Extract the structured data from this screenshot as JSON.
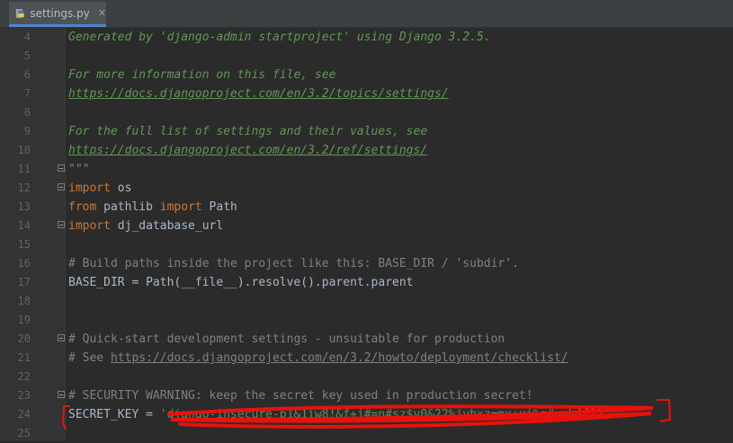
{
  "tab": {
    "filename": "settings.py",
    "icon": "python-file-icon",
    "close_glyph": "✕"
  },
  "colors": {
    "background": "#2b2b2b",
    "gutter": "#313335",
    "line_number": "#606366",
    "docstring": "#629755",
    "keyword": "#cc7832",
    "comment": "#808080",
    "string": "#6a8759",
    "text": "#a9b7c6",
    "redaction": "#e8120c"
  },
  "lines": [
    {
      "n": "4",
      "segments": [
        {
          "t": "Generated by 'django-admin startproject' using Django 3.2.5.",
          "c": "doc"
        }
      ]
    },
    {
      "n": "5",
      "segments": []
    },
    {
      "n": "6",
      "segments": [
        {
          "t": "For more information on this file, see",
          "c": "doc"
        }
      ]
    },
    {
      "n": "7",
      "segments": [
        {
          "t": "https://docs.djangoproject.com/en/3.2/topics/settings/",
          "c": "doc-link"
        }
      ]
    },
    {
      "n": "8",
      "segments": []
    },
    {
      "n": "9",
      "segments": [
        {
          "t": "For the full list of settings and their values, see",
          "c": "doc"
        }
      ]
    },
    {
      "n": "10",
      "segments": [
        {
          "t": "https://docs.djangoproject.com/en/3.2/ref/settings/",
          "c": "doc-link"
        }
      ]
    },
    {
      "n": "11",
      "fold": true,
      "segments": [
        {
          "t": "\"\"\"",
          "c": "doc"
        }
      ]
    },
    {
      "n": "12",
      "fold": true,
      "segments": [
        {
          "t": "import",
          "c": "kw"
        },
        {
          "t": " os",
          "c": ""
        }
      ]
    },
    {
      "n": "13",
      "segments": [
        {
          "t": "from",
          "c": "kw"
        },
        {
          "t": " pathlib ",
          "c": ""
        },
        {
          "t": "import",
          "c": "kw"
        },
        {
          "t": " Path",
          "c": ""
        }
      ]
    },
    {
      "n": "14",
      "fold": true,
      "segments": [
        {
          "t": "import",
          "c": "kw"
        },
        {
          "t": " dj_database_url",
          "c": ""
        }
      ]
    },
    {
      "n": "15",
      "segments": []
    },
    {
      "n": "16",
      "segments": [
        {
          "t": "# Build paths inside the project like this: BASE_DIR / 'subdir'.",
          "c": "cmt"
        }
      ]
    },
    {
      "n": "17",
      "segments": [
        {
          "t": "BASE_DIR = Path(__file__).resolve().parent.parent",
          "c": ""
        }
      ]
    },
    {
      "n": "18",
      "segments": []
    },
    {
      "n": "19",
      "segments": []
    },
    {
      "n": "20",
      "fold": true,
      "segments": [
        {
          "t": "# Quick-start development settings - unsuitable for production",
          "c": "cmt"
        }
      ]
    },
    {
      "n": "21",
      "segments": [
        {
          "t": "# See ",
          "c": "cmt"
        },
        {
          "t": "https://docs.djangoproject.com/en/3.2/howto/deployment/checklist/",
          "c": "cmt-link"
        }
      ]
    },
    {
      "n": "22",
      "segments": []
    },
    {
      "n": "23",
      "fold": true,
      "segments": [
        {
          "t": "# SECURITY WARNING: keep the secret key used in production secret!",
          "c": "cmt"
        }
      ]
    },
    {
      "n": "24",
      "segments": [
        {
          "t": "SECRET_KEY = ",
          "c": ""
        },
        {
          "t": "'django-insecure-p1&1iw8!&f+j#=n#sz$v0&22%jvbxz=mx+ui%q#wgh4f12'",
          "c": "str"
        }
      ]
    },
    {
      "n": "25",
      "segments": []
    }
  ]
}
